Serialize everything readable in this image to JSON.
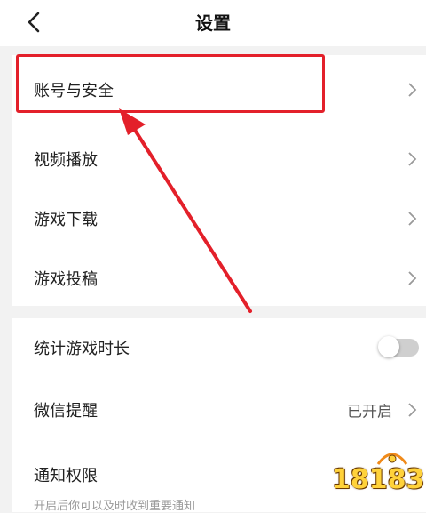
{
  "header": {
    "title": "设置",
    "back_icon": "chevron-left-icon"
  },
  "account_section": {
    "items": [
      {
        "label": "账号与安全",
        "icon": "chevron-right-icon",
        "highlighted": true
      },
      {
        "label": "视频播放",
        "icon": "chevron-right-icon"
      },
      {
        "label": "游戏下载",
        "icon": "chevron-right-icon"
      },
      {
        "label": "游戏投稿",
        "icon": "chevron-right-icon"
      }
    ]
  },
  "settings_section": {
    "play_time": {
      "label": "统计游戏时长",
      "toggle_on": false
    },
    "wechat_reminder": {
      "label": "微信提醒",
      "value": "已开启",
      "icon": "chevron-right-icon"
    },
    "notification": {
      "label": "通知权限",
      "description": "开启后你可以及时收到重要通知"
    }
  },
  "annotation": {
    "highlight_color": "#e3202a",
    "arrow_color": "#e3202a"
  },
  "watermark": {
    "text": "18183"
  }
}
